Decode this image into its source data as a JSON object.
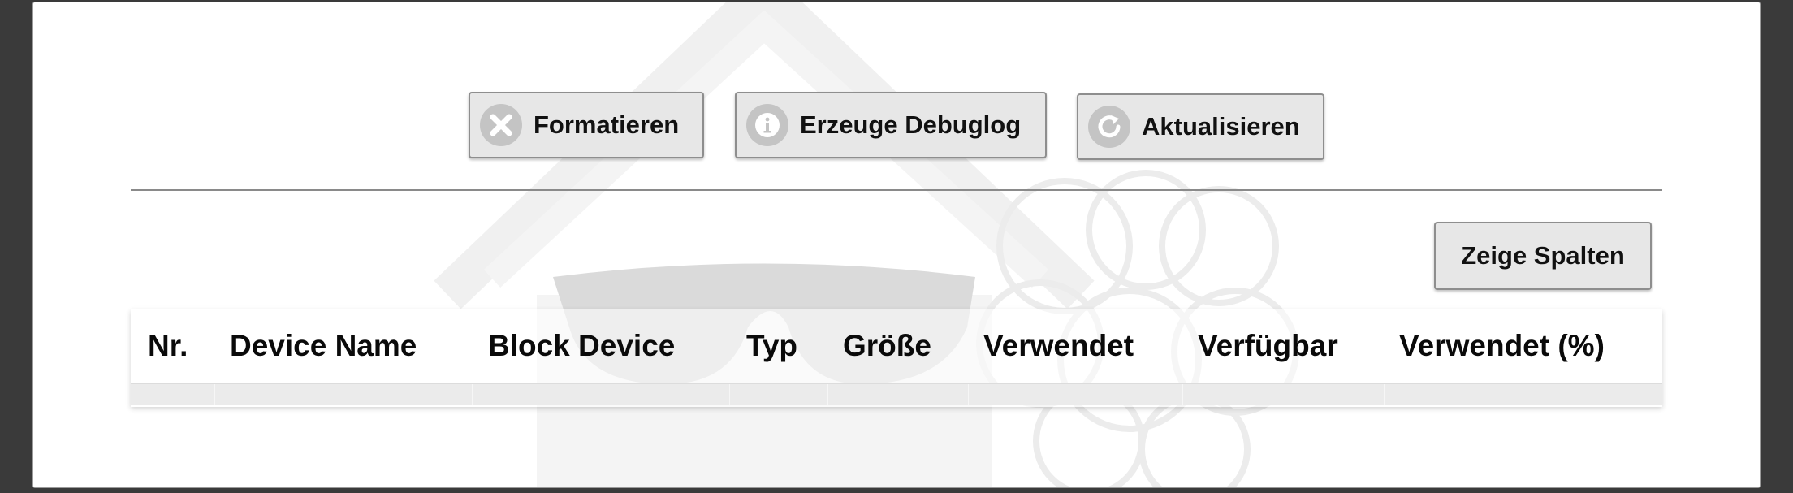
{
  "toolbar": {
    "format_label": "Formatieren",
    "debuglog_label": "Erzeuge Debuglog",
    "refresh_label": "Aktualisieren"
  },
  "columns_button_label": "Zeige Spalten",
  "table": {
    "headers": [
      "Nr.",
      "Device Name",
      "Block Device",
      "Typ",
      "Größe",
      "Verwendet",
      "Verfügbar",
      "Verwendet (%)"
    ],
    "rows": []
  },
  "icons": {
    "format": "close-circle-icon",
    "debuglog": "info-circle-icon",
    "refresh": "refresh-circle-icon"
  }
}
